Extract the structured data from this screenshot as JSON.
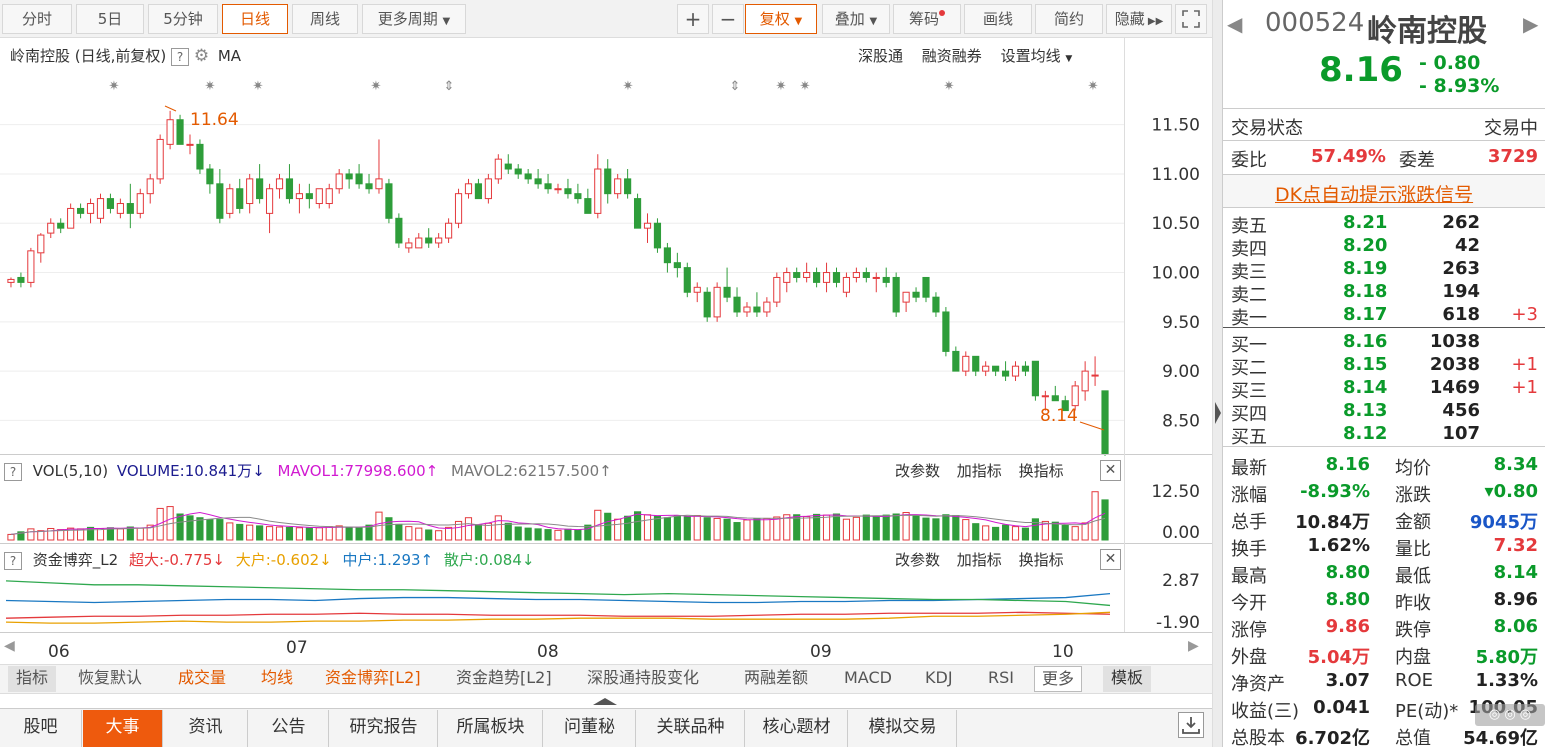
{
  "toolbar": {
    "periods": [
      "分时",
      "5日",
      "5分钟",
      "日线",
      "周线",
      "更多周期"
    ],
    "active_period": "日线",
    "zoom_in": "+",
    "zoom_out": "−",
    "adjust": "复权",
    "overlay": "叠加",
    "chips": "筹码",
    "draw": "画线",
    "simple": "简约",
    "hide": "隐藏"
  },
  "chart_header": {
    "title": "岭南控股 (日线,前复权)",
    "help": "?",
    "ma_label": "MA",
    "link_sgt": "深股通",
    "link_rzrq": "融资融券",
    "link_ma": "设置均线"
  },
  "vol_panel": {
    "title": "VOL(5,10)",
    "volume": "VOLUME:10.841万",
    "mavol1": "MAVOL1:77998.600",
    "mavol2": "MAVOL2:62157.500",
    "btn_param": "改参数",
    "btn_add": "加指标",
    "btn_switch": "换指标",
    "ticks": [
      "12.50",
      "0.00"
    ]
  },
  "fund_panel": {
    "title": "资金博弈_L2",
    "super": "超大:-0.775",
    "big": "大户:-0.602",
    "mid": "中户:1.293",
    "retail": "散户:0.084",
    "btn_param": "改参数",
    "btn_add": "加指标",
    "btn_switch": "换指标",
    "ticks": [
      "2.87",
      "-1.90"
    ]
  },
  "x_labels": [
    "06",
    "07",
    "08",
    "09",
    "10"
  ],
  "indicator_tabs": [
    "指标",
    "恢复默认",
    "成交量",
    "均线",
    "资金博弈[L2]",
    "资金趋势[L2]",
    "深股通持股变化",
    "两融差额",
    "MACD",
    "KDJ",
    "RSI",
    "更多",
    "模板"
  ],
  "bottom_tabs": [
    "股吧",
    "大事",
    "资讯",
    "公告",
    "研究报告",
    "所属板块",
    "问董秘",
    "关联品种",
    "核心题材",
    "模拟交易"
  ],
  "active_bottom_tab": "大事",
  "quote": {
    "code": "000524",
    "name": "岭南控股",
    "price": "8.16",
    "change": "- 0.80",
    "pct": "- 8.93%",
    "status_label": "交易状态",
    "status": "交易中",
    "wb_label": "委比",
    "wb": "57.49%",
    "wc_label": "委差",
    "wc": "3729",
    "dk_link": "DK点自动提示涨跌信号",
    "asks": [
      {
        "label": "卖五",
        "price": "8.21",
        "vol": "262",
        "chg": ""
      },
      {
        "label": "卖四",
        "price": "8.20",
        "vol": "42",
        "chg": ""
      },
      {
        "label": "卖三",
        "price": "8.19",
        "vol": "263",
        "chg": ""
      },
      {
        "label": "卖二",
        "price": "8.18",
        "vol": "194",
        "chg": ""
      },
      {
        "label": "卖一",
        "price": "8.17",
        "vol": "618",
        "chg": "+3"
      }
    ],
    "bids": [
      {
        "label": "买一",
        "price": "8.16",
        "vol": "1038",
        "chg": ""
      },
      {
        "label": "买二",
        "price": "8.15",
        "vol": "2038",
        "chg": "+1"
      },
      {
        "label": "买三",
        "price": "8.14",
        "vol": "1469",
        "chg": "+1"
      },
      {
        "label": "买四",
        "price": "8.13",
        "vol": "456",
        "chg": ""
      },
      {
        "label": "买五",
        "price": "8.12",
        "vol": "107",
        "chg": ""
      }
    ],
    "stats": [
      {
        "l1": "最新",
        "v1": "8.16",
        "c1": "gr",
        "l2": "均价",
        "v2": "8.34",
        "c2": "gr"
      },
      {
        "l1": "涨幅",
        "v1": "-8.93%",
        "c1": "gr",
        "l2": "涨跌",
        "v2": "▾0.80",
        "c2": "gr"
      },
      {
        "l1": "总手",
        "v1": "10.84万",
        "c1": "bk",
        "l2": "金额",
        "v2": "9045万",
        "c2": "bl"
      },
      {
        "l1": "换手",
        "v1": "1.62%",
        "c1": "bk",
        "l2": "量比",
        "v2": "7.32",
        "c2": "rd"
      },
      {
        "l1": "最高",
        "v1": "8.80",
        "c1": "gr",
        "l2": "最低",
        "v2": "8.14",
        "c2": "gr"
      },
      {
        "l1": "今开",
        "v1": "8.80",
        "c1": "gr",
        "l2": "昨收",
        "v2": "8.96",
        "c2": "bk"
      },
      {
        "l1": "涨停",
        "v1": "9.86",
        "c1": "rd",
        "l2": "跌停",
        "v2": "8.06",
        "c2": "gr"
      },
      {
        "l1": "外盘",
        "v1": "5.04万",
        "c1": "rd",
        "l2": "内盘",
        "v2": "5.80万",
        "c2": "gr"
      },
      {
        "l1": "净资产",
        "v1": "3.07",
        "c1": "bk",
        "l2": "ROE",
        "v2": "1.33%",
        "c2": "bk"
      },
      {
        "l1": "收益(三)",
        "v1": "0.041",
        "c1": "bk",
        "l2": "PE(动)*",
        "v2": "100.05",
        "c2": "bk"
      },
      {
        "l1": "总股本",
        "v1": "6.702亿",
        "c1": "bk",
        "l2": "总值",
        "v2": "54.69亿",
        "c2": "bk"
      }
    ]
  },
  "chart_data": {
    "type": "candlestick",
    "y_ticks": [
      "11.50",
      "11.00",
      "10.50",
      "10.00",
      "9.50",
      "9.00",
      "8.50"
    ],
    "ylim": [
      8.2,
      11.75
    ],
    "high_label": "11.64",
    "low_label": "8.14",
    "ohlc": [
      [
        9.9,
        9.95,
        9.85,
        9.93
      ],
      [
        9.95,
        10.0,
        9.85,
        9.9
      ],
      [
        9.9,
        10.25,
        9.85,
        10.22
      ],
      [
        10.2,
        10.4,
        10.1,
        10.38
      ],
      [
        10.4,
        10.55,
        10.35,
        10.5
      ],
      [
        10.5,
        10.55,
        10.4,
        10.45
      ],
      [
        10.45,
        10.7,
        10.45,
        10.65
      ],
      [
        10.65,
        10.7,
        10.55,
        10.6
      ],
      [
        10.6,
        10.75,
        10.5,
        10.7
      ],
      [
        10.55,
        10.8,
        10.5,
        10.75
      ],
      [
        10.75,
        10.8,
        10.6,
        10.65
      ],
      [
        10.6,
        10.75,
        10.55,
        10.7
      ],
      [
        10.7,
        10.9,
        10.45,
        10.6
      ],
      [
        10.6,
        10.85,
        10.55,
        10.8
      ],
      [
        10.8,
        11.0,
        10.7,
        10.95
      ],
      [
        10.95,
        11.4,
        10.9,
        11.35
      ],
      [
        11.3,
        11.64,
        11.25,
        11.55
      ],
      [
        11.55,
        11.6,
        11.3,
        11.3
      ],
      [
        11.3,
        11.4,
        11.2,
        11.3
      ],
      [
        11.3,
        11.35,
        11.0,
        11.05
      ],
      [
        11.05,
        11.1,
        10.8,
        10.9
      ],
      [
        10.9,
        11.05,
        10.5,
        10.55
      ],
      [
        10.6,
        10.9,
        10.55,
        10.85
      ],
      [
        10.85,
        10.95,
        10.6,
        10.65
      ],
      [
        10.7,
        11.0,
        10.6,
        10.95
      ],
      [
        10.95,
        11.1,
        10.7,
        10.75
      ],
      [
        10.6,
        10.9,
        10.4,
        10.85
      ],
      [
        10.85,
        11.0,
        10.75,
        10.95
      ],
      [
        10.95,
        11.1,
        10.7,
        10.75
      ],
      [
        10.75,
        10.9,
        10.6,
        10.8
      ],
      [
        10.8,
        10.9,
        10.65,
        10.75
      ],
      [
        10.7,
        10.85,
        10.65,
        10.85
      ],
      [
        10.7,
        10.9,
        10.65,
        10.85
      ],
      [
        10.85,
        11.05,
        10.8,
        11.0
      ],
      [
        11.0,
        11.05,
        10.85,
        10.95
      ],
      [
        11.0,
        11.1,
        10.85,
        10.9
      ],
      [
        10.9,
        11.0,
        10.8,
        10.85
      ],
      [
        10.85,
        11.35,
        10.8,
        10.95
      ],
      [
        10.9,
        10.95,
        10.5,
        10.55
      ],
      [
        10.55,
        10.6,
        10.25,
        10.3
      ],
      [
        10.25,
        10.35,
        10.2,
        10.3
      ],
      [
        10.25,
        10.4,
        10.25,
        10.35
      ],
      [
        10.35,
        10.45,
        10.25,
        10.3
      ],
      [
        10.3,
        10.4,
        10.25,
        10.35
      ],
      [
        10.35,
        10.55,
        10.3,
        10.5
      ],
      [
        10.5,
        10.85,
        10.45,
        10.8
      ],
      [
        10.8,
        10.95,
        10.75,
        10.9
      ],
      [
        10.9,
        10.95,
        10.75,
        10.75
      ],
      [
        10.75,
        11.0,
        10.7,
        10.95
      ],
      [
        10.95,
        11.2,
        10.9,
        11.15
      ],
      [
        11.1,
        11.2,
        11.0,
        11.05
      ],
      [
        11.05,
        11.1,
        10.95,
        11.0
      ],
      [
        11.0,
        11.05,
        10.9,
        10.95
      ],
      [
        10.95,
        11.05,
        10.85,
        10.9
      ],
      [
        10.9,
        11.0,
        10.8,
        10.85
      ],
      [
        10.85,
        10.9,
        10.8,
        10.85
      ],
      [
        10.85,
        10.95,
        10.75,
        10.8
      ],
      [
        10.8,
        10.9,
        10.7,
        10.75
      ],
      [
        10.75,
        10.85,
        10.65,
        10.6
      ],
      [
        10.6,
        11.2,
        10.55,
        11.05
      ],
      [
        11.05,
        11.15,
        10.7,
        10.8
      ],
      [
        10.8,
        11.0,
        10.75,
        10.95
      ],
      [
        10.95,
        11.05,
        10.75,
        10.8
      ],
      [
        10.75,
        10.8,
        10.45,
        10.45
      ],
      [
        10.45,
        10.6,
        10.3,
        10.5
      ],
      [
        10.5,
        10.55,
        10.2,
        10.25
      ],
      [
        10.25,
        10.3,
        10.0,
        10.1
      ],
      [
        10.1,
        10.2,
        9.95,
        10.05
      ],
      [
        10.05,
        10.1,
        9.75,
        9.8
      ],
      [
        9.8,
        9.9,
        9.7,
        9.85
      ],
      [
        9.8,
        9.85,
        9.5,
        9.55
      ],
      [
        9.55,
        9.9,
        9.5,
        9.85
      ],
      [
        9.85,
        10.05,
        9.7,
        9.75
      ],
      [
        9.75,
        9.85,
        9.55,
        9.6
      ],
      [
        9.6,
        9.7,
        9.55,
        9.65
      ],
      [
        9.65,
        9.8,
        9.55,
        9.6
      ],
      [
        9.6,
        9.75,
        9.55,
        9.7
      ],
      [
        9.7,
        10.0,
        9.65,
        9.95
      ],
      [
        9.9,
        10.05,
        9.8,
        10.0
      ],
      [
        10.0,
        10.05,
        9.9,
        9.95
      ],
      [
        9.95,
        10.1,
        9.9,
        10.0
      ],
      [
        10.0,
        10.05,
        9.85,
        9.9
      ],
      [
        9.9,
        10.1,
        9.8,
        10.0
      ],
      [
        10.0,
        10.05,
        9.85,
        9.9
      ],
      [
        9.8,
        10.0,
        9.75,
        9.95
      ],
      [
        9.95,
        10.05,
        9.9,
        10.0
      ],
      [
        10.0,
        10.05,
        9.9,
        9.95
      ],
      [
        9.95,
        10.0,
        9.8,
        9.95
      ],
      [
        9.95,
        10.05,
        9.85,
        9.9
      ],
      [
        9.95,
        10.0,
        9.55,
        9.6
      ],
      [
        9.7,
        9.8,
        9.6,
        9.8
      ],
      [
        9.8,
        9.85,
        9.7,
        9.75
      ],
      [
        9.95,
        9.95,
        9.7,
        9.75
      ],
      [
        9.75,
        9.8,
        9.55,
        9.6
      ],
      [
        9.6,
        9.65,
        9.15,
        9.2
      ],
      [
        9.2,
        9.25,
        9.0,
        9.0
      ],
      [
        9.0,
        9.2,
        8.95,
        9.15
      ],
      [
        9.15,
        9.15,
        8.95,
        9.0
      ],
      [
        9.0,
        9.1,
        8.95,
        9.05
      ],
      [
        9.05,
        9.05,
        8.95,
        9.0
      ],
      [
        9.0,
        9.1,
        8.9,
        8.95
      ],
      [
        8.95,
        9.1,
        8.9,
        9.05
      ],
      [
        9.05,
        9.1,
        8.95,
        9.0
      ],
      [
        9.1,
        9.1,
        8.7,
        8.75
      ],
      [
        8.75,
        8.8,
        8.6,
        8.75
      ],
      [
        8.75,
        8.85,
        8.7,
        8.7
      ],
      [
        8.7,
        8.75,
        8.6,
        8.6
      ],
      [
        8.65,
        8.9,
        8.6,
        8.85
      ],
      [
        8.8,
        9.1,
        8.7,
        9.0
      ],
      [
        8.96,
        9.15,
        8.85,
        8.96
      ],
      [
        8.8,
        8.8,
        8.14,
        8.16
      ]
    ],
    "volume": [
      1.5,
      2.2,
      3.0,
      2.5,
      3.1,
      2.8,
      3.2,
      3.0,
      3.4,
      3.1,
      3.3,
      3.0,
      3.5,
      3.2,
      4.0,
      8.5,
      9.0,
      7.0,
      6.5,
      6.0,
      5.5,
      5.5,
      4.6,
      4.2,
      4.0,
      3.8,
      3.6,
      3.5,
      3.4,
      3.3,
      3.2,
      3.3,
      3.6,
      3.8,
      3.4,
      3.3,
      4.0,
      7.5,
      6.0,
      4.2,
      3.6,
      3.2,
      2.7,
      2.5,
      3.4,
      5.0,
      6.0,
      4.0,
      4.5,
      6.5,
      4.5,
      3.5,
      3.2,
      3.0,
      2.8,
      2.6,
      2.9,
      2.7,
      4.0,
      8.0,
      7.2,
      5.6,
      6.4,
      7.6,
      6.8,
      6.4,
      6.0,
      6.6,
      6.2,
      6.6,
      6.0,
      5.8,
      5.6,
      4.7,
      5.4,
      5.8,
      5.8,
      6.2,
      6.8,
      6.8,
      6.3,
      6.9,
      6.7,
      7.0,
      5.6,
      6.1,
      6.7,
      6.4,
      6.7,
      7.0,
      7.4,
      6.6,
      5.9,
      5.7,
      6.8,
      6.6,
      5.5,
      4.4,
      3.8,
      3.4,
      4.0,
      3.6,
      3.2,
      5.7,
      5.0,
      4.8,
      3.9,
      3.6,
      4.6,
      13.0,
      10.8
    ],
    "vol_down": [
      0,
      1,
      0,
      0,
      0,
      0,
      0,
      0,
      1,
      0,
      1,
      0,
      1,
      0,
      0,
      0,
      0,
      1,
      1,
      1,
      1,
      1,
      0,
      1,
      0,
      1,
      0,
      0,
      1,
      0,
      1,
      0,
      0,
      0,
      1,
      1,
      1,
      0,
      1,
      1,
      0,
      0,
      1,
      0,
      0,
      0,
      0,
      1,
      0,
      0,
      1,
      1,
      1,
      1,
      1,
      0,
      1,
      1,
      1,
      0,
      1,
      0,
      1,
      1,
      0,
      1,
      1,
      1,
      1,
      0,
      1,
      0,
      1,
      1,
      0,
      1,
      0,
      0,
      0,
      1,
      0,
      1,
      0,
      1,
      0,
      0,
      1,
      1,
      1,
      1,
      0,
      1,
      1,
      1,
      1,
      1,
      0,
      1,
      0,
      1,
      1,
      0,
      1,
      1,
      0,
      1,
      1,
      0,
      0,
      0,
      1
    ],
    "vol_ylim": [
      0,
      14
    ],
    "fund_lines": [
      {
        "name": "超大",
        "color": "#e4393c",
        "values": [
          -1.2,
          -1.1,
          -1.0,
          -1.0,
          -0.9,
          -0.9,
          -0.8,
          -0.8,
          -0.7,
          -0.8,
          -0.8,
          -0.9,
          -0.9,
          -0.9,
          -1.0,
          -1.0,
          -1.0,
          -0.9,
          -0.8,
          -0.8,
          -0.7,
          -0.7,
          -0.7,
          -0.6,
          -0.7,
          -0.8
        ]
      },
      {
        "name": "大户",
        "color": "#e8a000",
        "values": [
          -1.6,
          -1.7,
          -1.7,
          -1.6,
          -1.5,
          -1.6,
          -1.6,
          -1.5,
          -1.5,
          -1.4,
          -1.4,
          -1.3,
          -1.3,
          -1.2,
          -1.2,
          -1.2,
          -1.3,
          -1.3,
          -1.3,
          -1.3,
          -1.2,
          -1.0,
          -1.0,
          -0.9,
          -0.8,
          -0.6
        ]
      },
      {
        "name": "中户",
        "color": "#1a78c2",
        "values": [
          0.6,
          0.5,
          0.4,
          0.5,
          0.6,
          0.7,
          0.7,
          0.6,
          0.8,
          0.9,
          0.9,
          0.8,
          0.7,
          0.7,
          0.6,
          0.5,
          0.4,
          0.4,
          0.5,
          0.5,
          0.6,
          0.6,
          0.7,
          0.8,
          0.9,
          1.3
        ]
      },
      {
        "name": "散户",
        "color": "#2fa84f",
        "values": [
          2.6,
          2.4,
          2.2,
          2.2,
          2.1,
          2.0,
          1.9,
          1.8,
          1.7,
          1.7,
          1.6,
          1.5,
          1.4,
          1.3,
          1.2,
          1.3,
          1.2,
          1.1,
          1.0,
          0.9,
          0.8,
          0.7,
          0.7,
          0.6,
          0.5,
          0.1
        ]
      }
    ],
    "fund_ylim": [
      -2.2,
      3.2
    ]
  }
}
